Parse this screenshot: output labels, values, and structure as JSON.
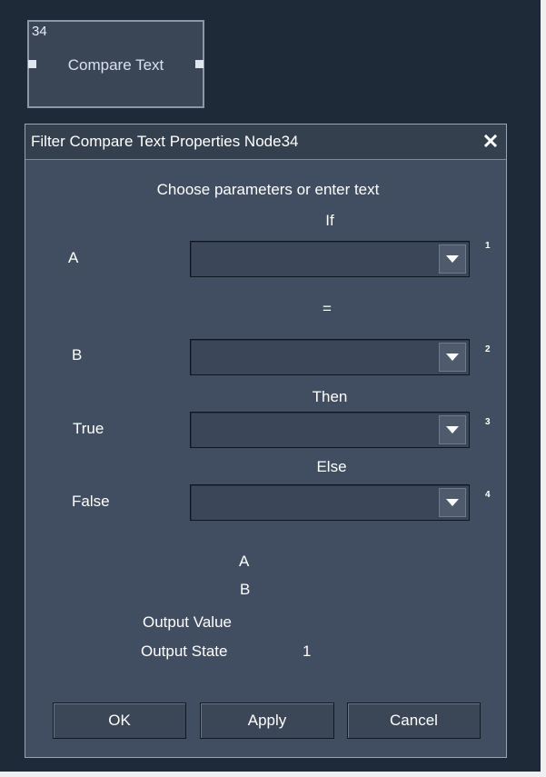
{
  "node": {
    "id": "34",
    "label": "Compare Text"
  },
  "dialog": {
    "title": "Filter Compare Text Properties Node34",
    "close_icon": "close-icon",
    "instruction": "Choose parameters or enter text",
    "if_label": "If",
    "equals_label": "=",
    "then_label": "Then",
    "else_label": "Else",
    "fields": {
      "a": {
        "label": "A",
        "value": "",
        "index": "1"
      },
      "b": {
        "label": "B",
        "value": "",
        "index": "2"
      },
      "true": {
        "label": "True",
        "value": "",
        "index": "3"
      },
      "false": {
        "label": "False",
        "value": "",
        "index": "4"
      }
    },
    "summary": {
      "a_label": "A",
      "b_label": "B",
      "output_value_label": "Output Value",
      "output_state_label": "Output State",
      "output_state_value": "1"
    },
    "buttons": {
      "ok": "OK",
      "apply": "Apply",
      "cancel": "Cancel"
    }
  }
}
